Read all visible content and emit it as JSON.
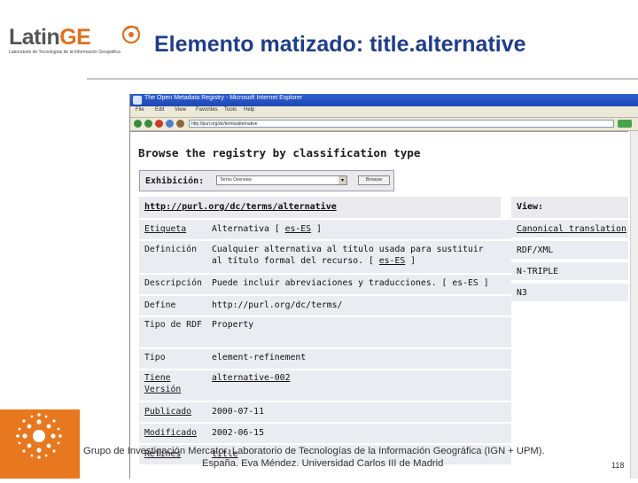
{
  "slide": {
    "logo": {
      "word_left": "Latin",
      "word_right": "GE",
      "subtitle": "Laboratorio de Tecnologías de la Información Geográfica"
    },
    "title": "Elemento matizado: title.alternative",
    "footer_line1": "Grupo de Investigación Mercator. Laboratorio de Tecnologías de la Información Geográfica (IGN + UPM).",
    "footer_line2": "España. Eva Méndez. Universidad Carlos III de Madrid",
    "page_number": "118",
    "colors": {
      "title": "#1f3d8c",
      "logo_accent": "#e0701d",
      "footer_logo_bg": "#e87820"
    }
  },
  "browser": {
    "window_title": "The Open Metadata Registry - Microsoft Internet Explorer",
    "menu": [
      "File",
      "Edit",
      "View",
      "Favorites",
      "Tools",
      "Help"
    ],
    "toolbar_icons": [
      "back-icon",
      "forward-icon",
      "stop-icon",
      "refresh-icon",
      "home-icon"
    ],
    "address": "http://purl.org/dc/terms/alternative",
    "window_buttons": [
      "_",
      "□",
      "×"
    ]
  },
  "page": {
    "heading": "Browse the registry by classification type",
    "exhibition": {
      "label": "Exhibición:",
      "selected": "Terms Overview",
      "button": "Browse"
    },
    "uri": "http://purl.org/dc/terms/alternative",
    "rows": [
      {
        "key": "Etiqueta",
        "value_pre": "Alternativa [ ",
        "value_link": "es-ES",
        "value_post": " ]"
      },
      {
        "key": "Definición",
        "value_pre": "Cualquier alternativa al título usada para sustituir al título formal del recurso. [ ",
        "value_link": "es-ES",
        "value_post": " ]"
      },
      {
        "key": "Descripción",
        "value_pre": "Puede incluir abreviaciones y traducciones. [ es-ES ]",
        "value_link": "",
        "value_post": ""
      },
      {
        "key": "Define",
        "value_pre": "http://purl.org/dc/terms/",
        "value_link": "",
        "value_post": ""
      },
      {
        "key": "Tipo de RDF",
        "value_pre": "Property",
        "value_link": "",
        "value_post": ""
      },
      {
        "key": "Tipo",
        "value_pre": "element-refinement",
        "value_link": "",
        "value_post": ""
      },
      {
        "key": "Tiene Versión",
        "value_pre": "",
        "value_link": "alternative-002",
        "value_post": ""
      },
      {
        "key": "Publicado",
        "value_pre": "2000-07-11",
        "value_link": "",
        "value_post": ""
      },
      {
        "key": "Modificado",
        "value_pre": "2002-06-15",
        "value_link": "",
        "value_post": ""
      },
      {
        "key": "Refines",
        "value_pre": "title",
        "value_link": "",
        "value_post": ""
      }
    ],
    "view": {
      "label": "View:",
      "items": [
        "Canonical translation",
        "RDF/XML",
        "N-TRIPLE",
        "N3"
      ]
    }
  }
}
